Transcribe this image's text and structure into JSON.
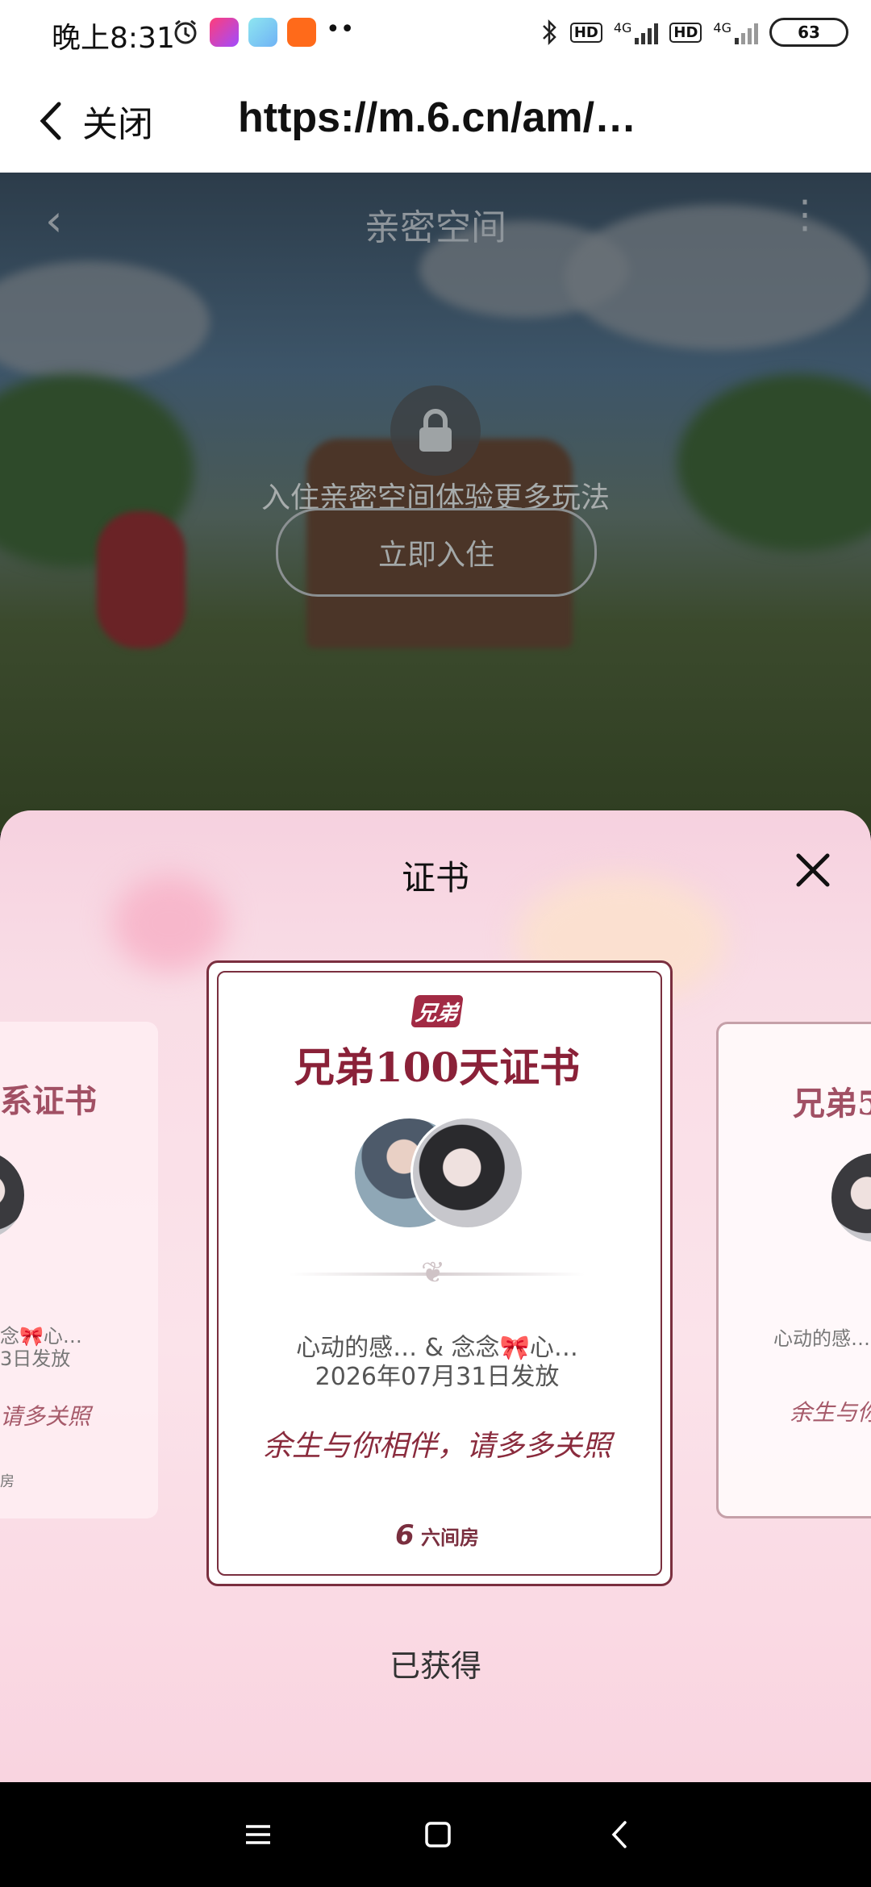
{
  "status_bar": {
    "time": "晚上8:31",
    "battery": "63",
    "hd1": "HD",
    "hd2": "HD",
    "net1": "4G",
    "net2": "4G"
  },
  "browser": {
    "close_label": "关闭",
    "url": "https://m.6.cn/am/…"
  },
  "page": {
    "title": "亲密空间",
    "hint": "入住亲密空间体验更多玩法",
    "enter_button": "立即入住"
  },
  "sheet": {
    "title": "证书",
    "main_card": {
      "tag": "兄弟",
      "title": "兄弟100天证书",
      "names": "心动的感…   & 念念🎀心…",
      "date": "2026年07月31日发放",
      "slogan": "余生与你相伴，请多多关照",
      "brand": "六间房"
    },
    "left_card": {
      "title": "系证书",
      "names": "念🎀心…",
      "date": "3日发放",
      "slogan": "请多关照",
      "footer": "房"
    },
    "right_card": {
      "title": "兄弟5",
      "names": "心动的感…",
      "slogan": "余生与你"
    },
    "status": "已获得"
  }
}
